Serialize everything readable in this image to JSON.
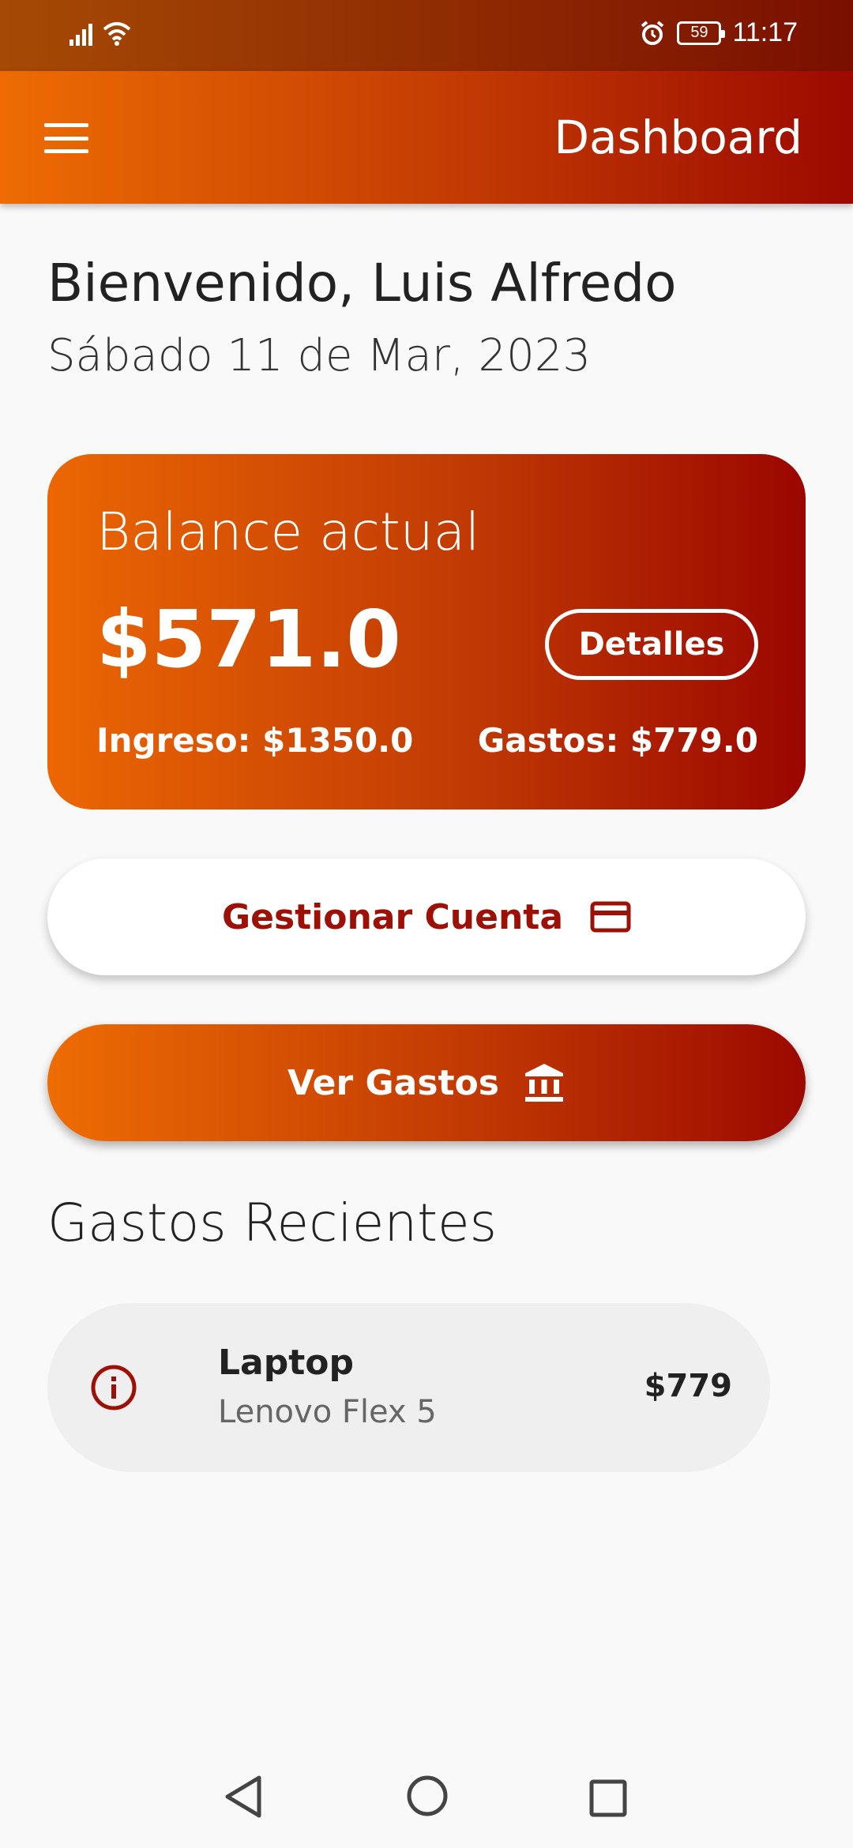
{
  "status_bar": {
    "time": "11:17",
    "battery": "59",
    "icons": [
      "signal-icon",
      "wifi-icon",
      "alarm-icon",
      "battery-icon"
    ]
  },
  "app_bar": {
    "title": "Dashboard",
    "menu_icon": "hamburger-menu-icon"
  },
  "greeting": {
    "welcome": "Bienvenido, Luis Alfredo",
    "date": "Sábado 11 de Mar, 2023"
  },
  "balance_card": {
    "label": "Balance actual",
    "amount": "$571.0",
    "details_button": "Detalles",
    "income": "Ingreso: $1350.0",
    "expenses": "Gastos: $779.0"
  },
  "actions": {
    "manage_account": "Gestionar Cuenta",
    "manage_account_icon": "credit-card-icon",
    "view_expenses": "Ver Gastos",
    "view_expenses_icon": "bank-icon"
  },
  "recent_expenses": {
    "title": "Gastos Recientes",
    "items": [
      {
        "icon": "info-icon",
        "title": "Laptop",
        "subtitle": "Lenovo Flex 5",
        "amount": "$779"
      }
    ]
  },
  "colors": {
    "brand_orange": "#ee6c03",
    "brand_red": "#9c0900",
    "accent_text": "#9c1006"
  }
}
